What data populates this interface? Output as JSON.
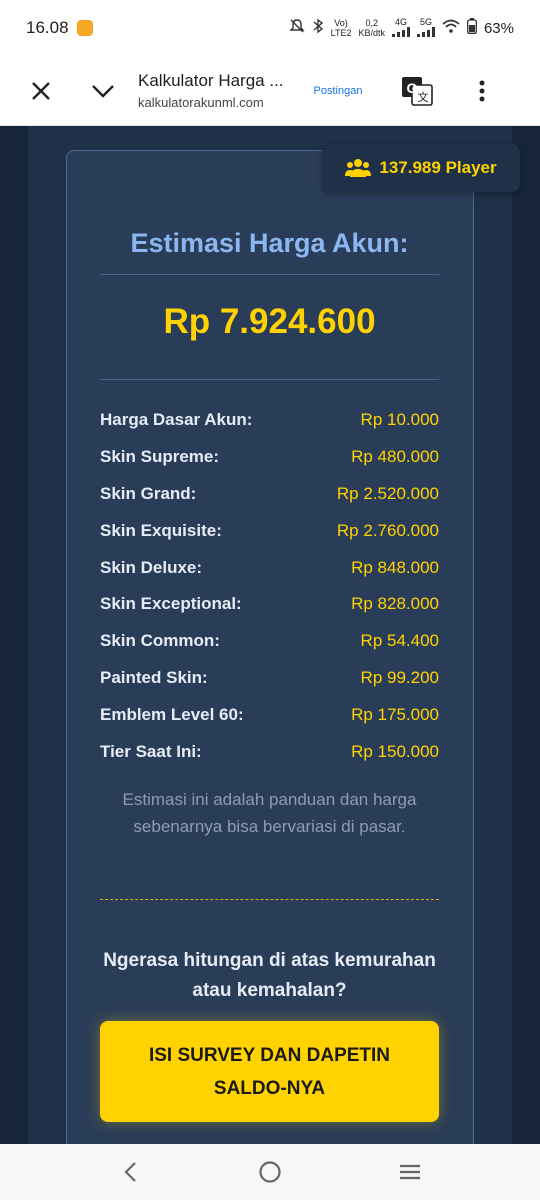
{
  "status": {
    "time": "16.08",
    "volte": "Vo)",
    "lte": "LTE2",
    "speed_value": "0,2",
    "speed_unit": "KB/dtk",
    "net1": "4G",
    "net2": "5G",
    "battery": "63%"
  },
  "browser": {
    "page_title": "Kalkulator Harga ...",
    "url": "kalkulatorakunml.com",
    "postingan": "Postingan"
  },
  "badge": {
    "text": "137.989 Player"
  },
  "estimate": {
    "title": "Estimasi Harga Akun:",
    "total": "Rp 7.924.600"
  },
  "rows": [
    {
      "label": "Harga Dasar Akun:",
      "value": "Rp 10.000"
    },
    {
      "label": "Skin Supreme:",
      "value": "Rp 480.000"
    },
    {
      "label": "Skin Grand:",
      "value": "Rp 2.520.000"
    },
    {
      "label": "Skin Exquisite:",
      "value": "Rp 2.760.000"
    },
    {
      "label": "Skin Deluxe:",
      "value": "Rp 848.000"
    },
    {
      "label": "Skin Exceptional:",
      "value": "Rp 828.000"
    },
    {
      "label": "Skin Common:",
      "value": "Rp 54.400"
    },
    {
      "label": "Painted Skin:",
      "value": "Rp 99.200"
    },
    {
      "label": "Emblem Level 60:",
      "value": "Rp 175.000"
    },
    {
      "label": "Tier Saat Ini:",
      "value": "Rp 150.000"
    }
  ],
  "note": "Estimasi ini adalah panduan dan harga sebenarnya bisa bervariasi di pasar.",
  "question": "Ngerasa hitungan di atas kemurahan atau kemahalan?",
  "survey_button": "ISI SURVEY DAN DAPETIN SALDO-NYA",
  "colors": {
    "accent_yellow": "#ffd200",
    "title_blue": "#8cb6f2",
    "card_bg": "#2a3d58",
    "page_bg": "#17253a"
  }
}
